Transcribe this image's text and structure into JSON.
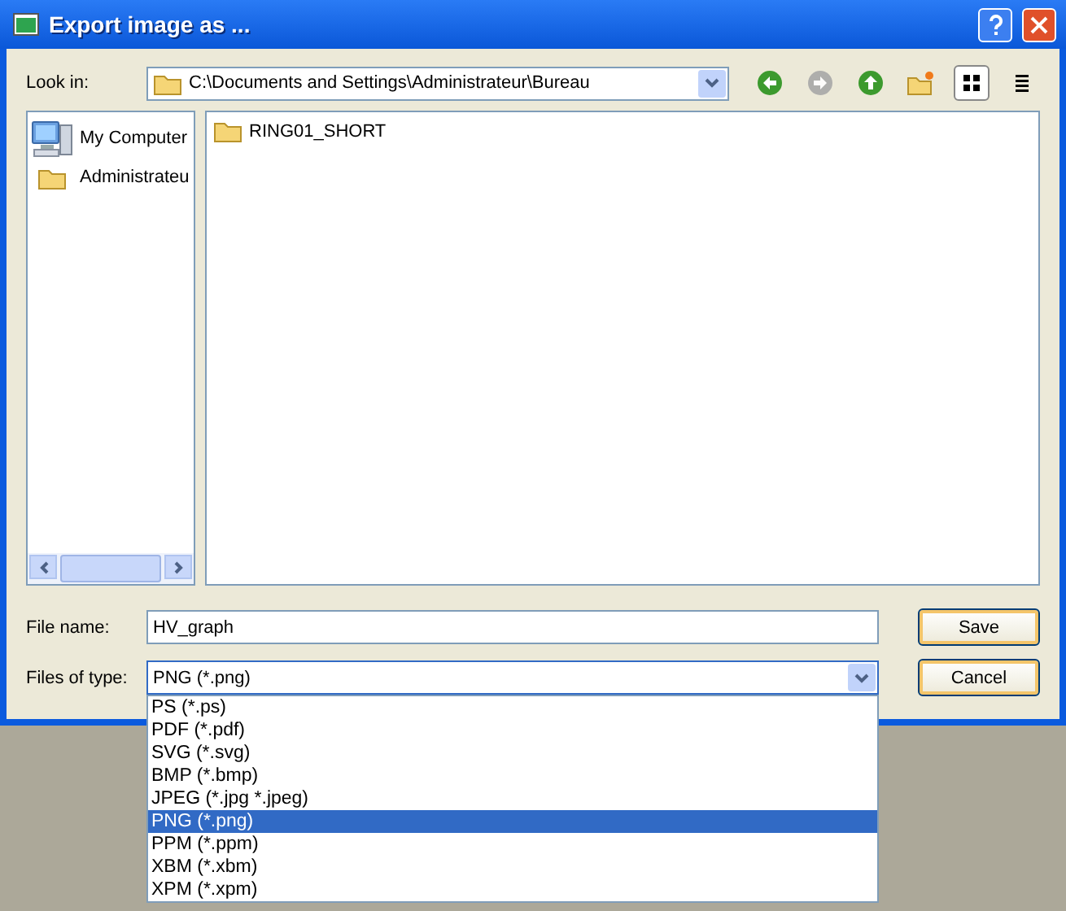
{
  "window": {
    "title": "Export image as ..."
  },
  "look_in": {
    "label": "Look in:",
    "path": "C:\\Documents and Settings\\Administrateur\\Bureau"
  },
  "toolbar": [
    {
      "kind": "back",
      "disabled": false,
      "selected": false
    },
    {
      "kind": "forward",
      "disabled": true,
      "selected": false
    },
    {
      "kind": "up",
      "disabled": false,
      "selected": false
    },
    {
      "kind": "newfolder",
      "disabled": false,
      "selected": false
    },
    {
      "kind": "iconview",
      "disabled": false,
      "selected": true
    },
    {
      "kind": "listview",
      "disabled": false,
      "selected": false
    }
  ],
  "sidebar": {
    "items": [
      {
        "kind": "computer",
        "label": "My Computer"
      },
      {
        "kind": "folder",
        "label": "Administrateu"
      }
    ]
  },
  "files": [
    {
      "kind": "folder",
      "name": "RING01_SHORT"
    }
  ],
  "file_name": {
    "label": "File name:",
    "value": "HV_graph"
  },
  "file_type": {
    "label": "Files of type:",
    "value": "PNG (*.png)",
    "expanded": true,
    "options": [
      {
        "label": "PS (*.ps)",
        "selected": false
      },
      {
        "label": "PDF (*.pdf)",
        "selected": false
      },
      {
        "label": "SVG (*.svg)",
        "selected": false
      },
      {
        "label": "BMP (*.bmp)",
        "selected": false
      },
      {
        "label": "JPEG (*.jpg *.jpeg)",
        "selected": false
      },
      {
        "label": "PNG (*.png)",
        "selected": true
      },
      {
        "label": "PPM (*.ppm)",
        "selected": false
      },
      {
        "label": "XBM (*.xbm)",
        "selected": false
      },
      {
        "label": "XPM (*.xpm)",
        "selected": false
      }
    ]
  },
  "buttons": [
    {
      "kind": "save",
      "label": "Save"
    },
    {
      "kind": "cancel",
      "label": "Cancel"
    }
  ]
}
